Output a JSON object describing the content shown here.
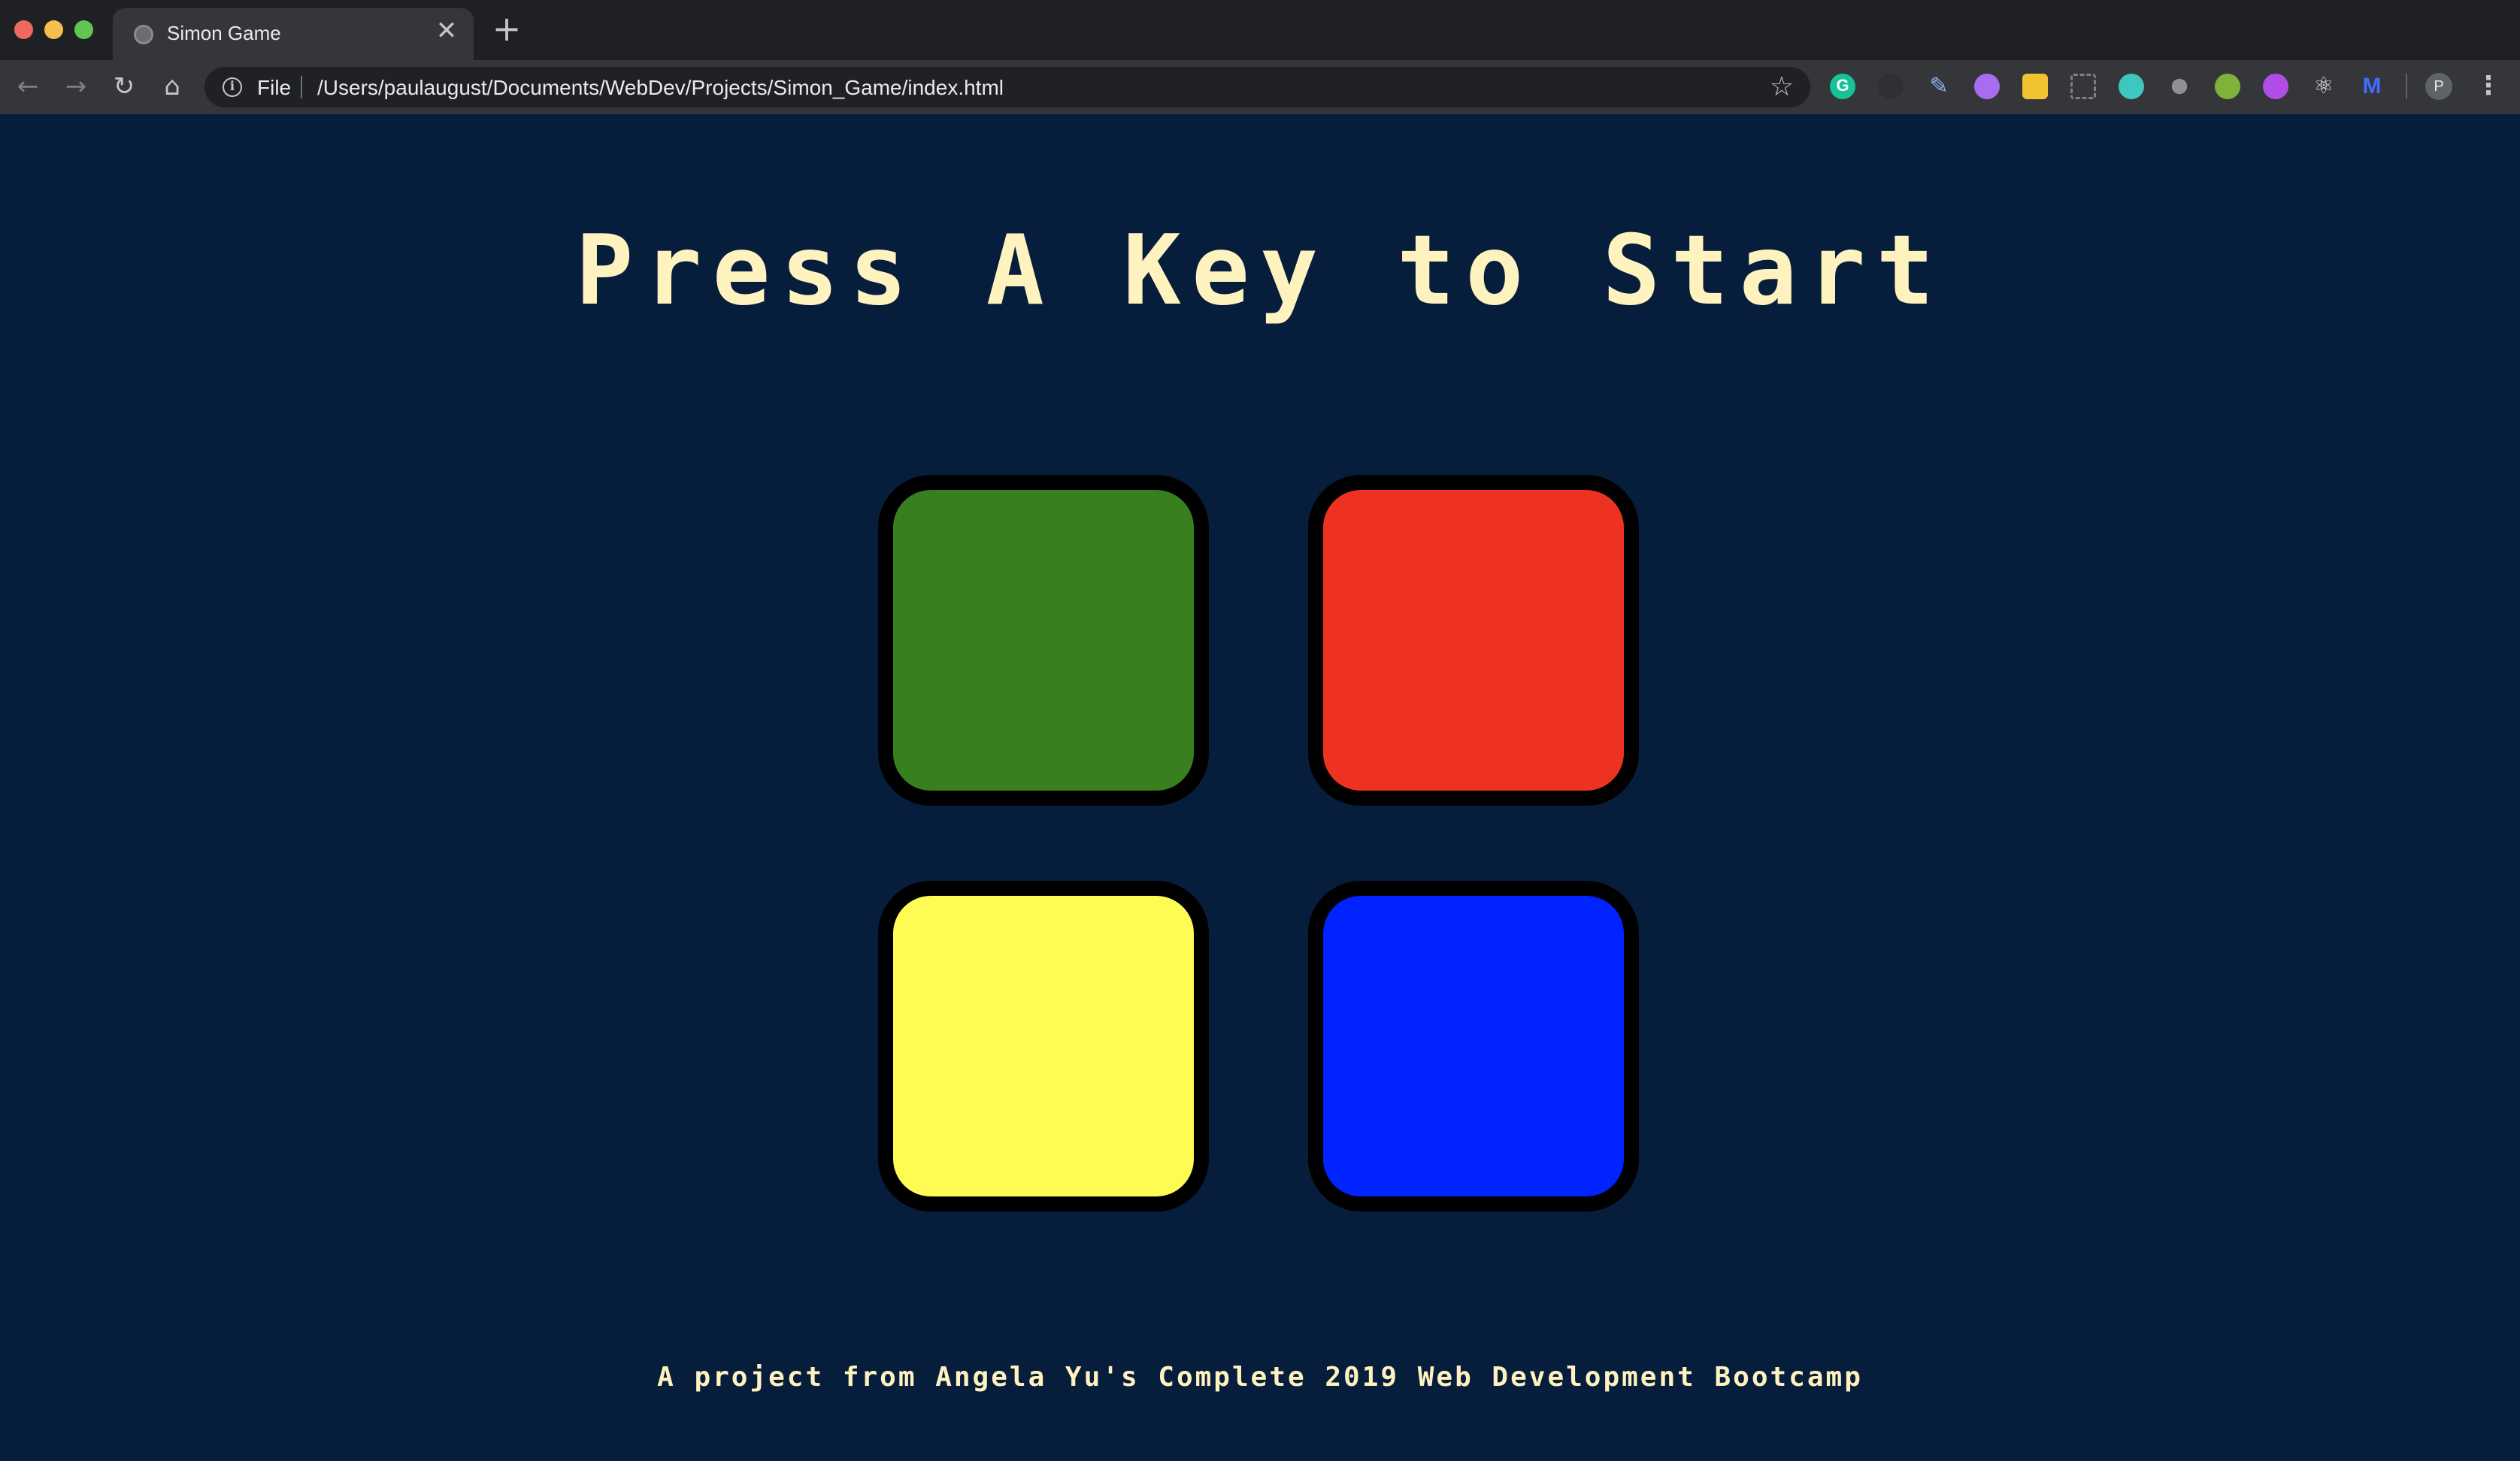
{
  "browser": {
    "tab": {
      "title": "Simon Game",
      "favicon": "globe-icon",
      "close_glyph": "✕"
    },
    "new_tab_glyph": "+",
    "nav": {
      "back_glyph": "←",
      "forward_glyph": "→",
      "reload_glyph": "↻",
      "home_glyph": "⌂"
    },
    "address": {
      "scheme_label": "File",
      "url": "/Users/paulaugust/Documents/WebDev/Projects/Simon_Game/index.html"
    },
    "bookmark_glyph": "☆",
    "extensions": [
      "grammarly-icon",
      "dark-extension-icon",
      "pen-icon",
      "purple-extension-icon",
      "notes-icon",
      "screenshot-frame-icon",
      "teal-extension-icon",
      "grey-extension-icon",
      "tree-icon",
      "violet-extension-icon",
      "react-devtools-icon",
      "m-extension-icon"
    ],
    "profile_initial": "P",
    "menu_glyph": "⋮"
  },
  "game": {
    "title": "Press A Key to Start",
    "buttons": [
      {
        "name": "green",
        "color": "#377f1f"
      },
      {
        "name": "red",
        "color": "#ee3222"
      },
      {
        "name": "yellow",
        "color": "#fffb55"
      },
      {
        "name": "blue",
        "color": "#0023ff"
      }
    ],
    "background_color": "#071d3c",
    "text_color": "#fef2bf"
  },
  "footer": {
    "text": "A project from Angela Yu's Complete 2019 Web Development Bootcamp"
  }
}
